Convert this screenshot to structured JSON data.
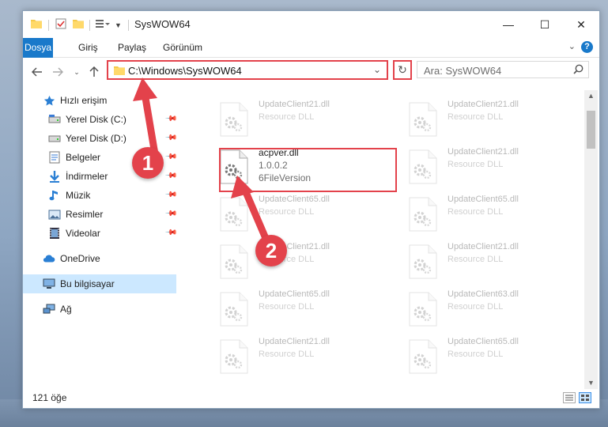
{
  "window": {
    "title": "SysWOW64",
    "controls": {
      "minimize": "—",
      "maximize": "☐",
      "close": "✕"
    }
  },
  "ribbon": {
    "tabs": [
      "Dosya",
      "Giriş",
      "Paylaş",
      "Görünüm"
    ],
    "help": "?"
  },
  "address": {
    "path": "C:\\Windows\\SysWOW64"
  },
  "search": {
    "placeholder": "Ara: SysWOW64"
  },
  "sidebar": {
    "quick_access": "Hızlı erişim",
    "items": [
      {
        "label": "Yerel Disk (C:)",
        "icon": "drive-icon"
      },
      {
        "label": "Yerel Disk (D:)",
        "icon": "drive-icon"
      },
      {
        "label": "Belgeler",
        "icon": "documents-icon"
      },
      {
        "label": "İndirmeler",
        "icon": "downloads-icon"
      },
      {
        "label": "Müzik",
        "icon": "music-icon"
      },
      {
        "label": "Resimler",
        "icon": "pictures-icon"
      },
      {
        "label": "Videolar",
        "icon": "videos-icon"
      }
    ],
    "onedrive": "OneDrive",
    "this_pc": "Bu bilgisayar",
    "network": "Ağ"
  },
  "files": {
    "col1": [
      {
        "name": "UpdateClient21.dll",
        "type": "Resource DLL",
        "faded": true
      },
      {
        "name": "acpver.dll",
        "version": "1.0.0.2",
        "type": "6FileVersion",
        "faded": false
      },
      {
        "name": "UpdateClient65.dll",
        "type": "Resource DLL",
        "faded": true
      },
      {
        "name": "UpdateClient21.dll",
        "type": "Resource DLL",
        "faded": true
      },
      {
        "name": "UpdateClient65.dll",
        "type": "Resource DLL",
        "faded": true
      },
      {
        "name": "UpdateClient21.dll",
        "type": "Resource DLL",
        "faded": true
      }
    ],
    "col2": [
      {
        "name": "UpdateClient21.dll",
        "type": "Resource DLL"
      },
      {
        "name": "UpdateClient21.dll",
        "type": "Resource DLL"
      },
      {
        "name": "UpdateClient65.dll",
        "type": "Resource DLL"
      },
      {
        "name": "UpdateClient21.dll",
        "type": "Resource DLL"
      },
      {
        "name": "UpdateClient63.dll",
        "type": "Resource DLL"
      },
      {
        "name": "UpdateClient65.dll",
        "type": "Resource DLL"
      }
    ]
  },
  "status": {
    "count": "121 öğe"
  },
  "annotations": {
    "step1": "1",
    "step2": "2",
    "color": "#e3424b"
  }
}
